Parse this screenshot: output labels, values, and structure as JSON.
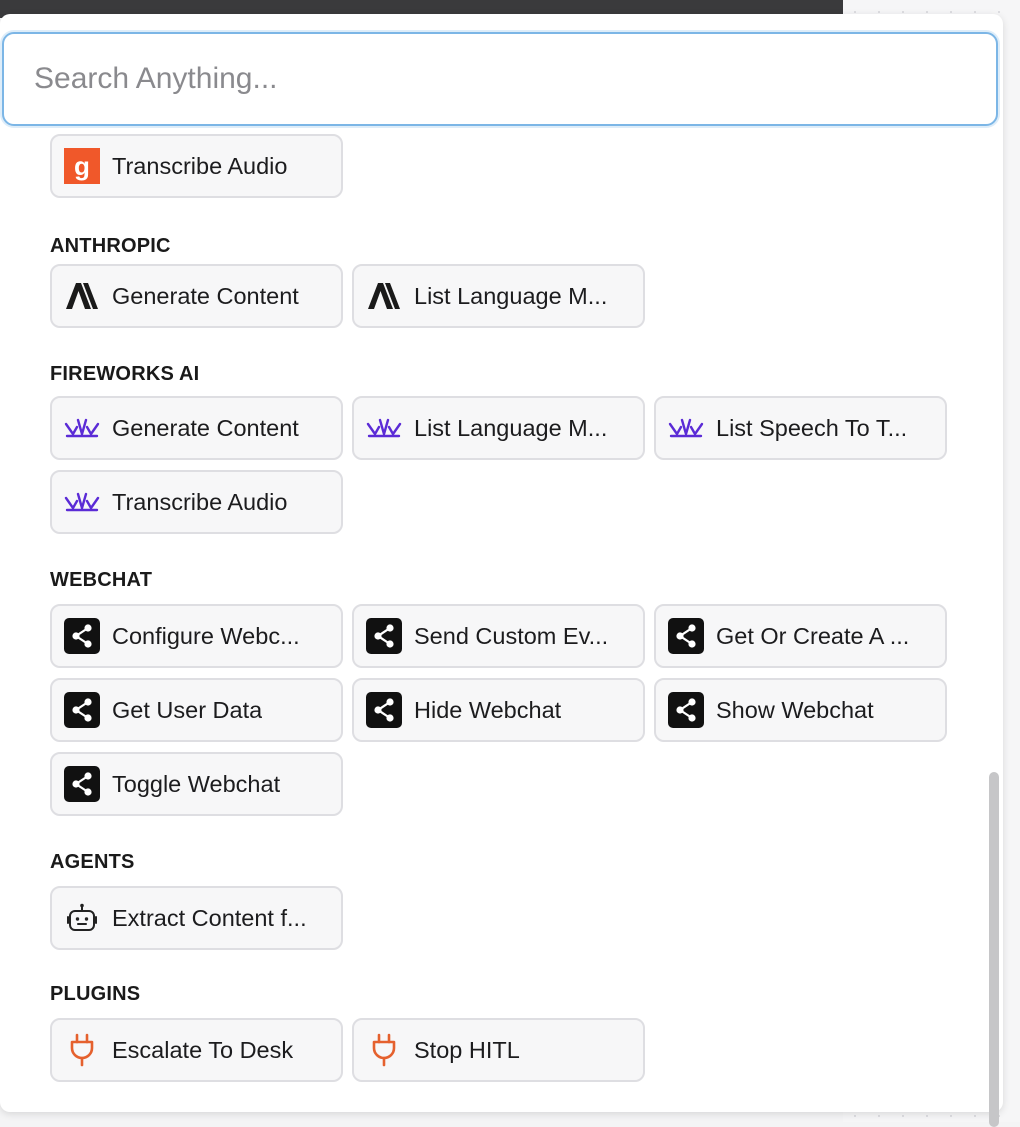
{
  "search": {
    "placeholder": "Search Anything..."
  },
  "sections": {
    "top": {
      "items": [
        {
          "label": "Transcribe Audio",
          "icon": "gladia-icon"
        }
      ]
    },
    "anthropic": {
      "title": "ANTHROPIC",
      "items": [
        {
          "label": "Generate Content",
          "icon": "anthropic-icon"
        },
        {
          "label": "List Language M...",
          "icon": "anthropic-icon"
        }
      ]
    },
    "fireworks": {
      "title": "FIREWORKS AI",
      "items": [
        {
          "label": "Generate Content",
          "icon": "fireworks-icon"
        },
        {
          "label": "List Language M...",
          "icon": "fireworks-icon"
        },
        {
          "label": "List Speech To T...",
          "icon": "fireworks-icon"
        },
        {
          "label": "Transcribe Audio",
          "icon": "fireworks-icon"
        }
      ]
    },
    "webchat": {
      "title": "WEBCHAT",
      "items": [
        {
          "label": "Configure Webc...",
          "icon": "share-icon"
        },
        {
          "label": "Send Custom Ev...",
          "icon": "share-icon"
        },
        {
          "label": "Get Or Create A ...",
          "icon": "share-icon"
        },
        {
          "label": "Get User Data",
          "icon": "share-icon"
        },
        {
          "label": "Hide Webchat",
          "icon": "share-icon"
        },
        {
          "label": "Show Webchat",
          "icon": "share-icon"
        },
        {
          "label": "Toggle Webchat",
          "icon": "share-icon"
        }
      ]
    },
    "agents": {
      "title": "AGENTS",
      "items": [
        {
          "label": "Extract Content f...",
          "icon": "robot-icon"
        }
      ]
    },
    "plugins": {
      "title": "PLUGINS",
      "items": [
        {
          "label": "Escalate To Desk",
          "icon": "plug-icon"
        },
        {
          "label": "Stop HITL",
          "icon": "plug-icon"
        }
      ]
    }
  },
  "colors": {
    "accent": "#7cb6e6",
    "gladia": "#f0582a",
    "fireworks": "#5b2bd6",
    "plug": "#e5612e"
  }
}
